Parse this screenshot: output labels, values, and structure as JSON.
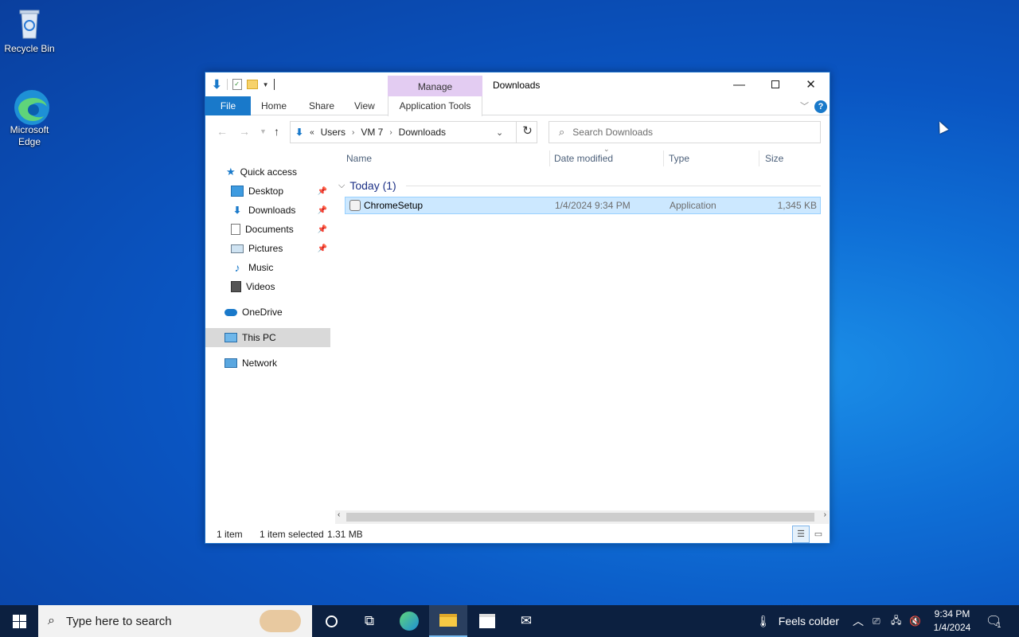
{
  "desktop": {
    "icons": [
      {
        "label": "Recycle Bin",
        "icon": "recycle-bin-icon"
      },
      {
        "label": "Microsoft Edge",
        "icon": "edge-icon"
      }
    ]
  },
  "window": {
    "title": "Downloads",
    "contextual_tab_group": "Manage",
    "ribbon_tabs": [
      "File",
      "Home",
      "Share",
      "View",
      "Application Tools"
    ],
    "controls": [
      "minimize",
      "maximize",
      "close"
    ]
  },
  "navigation": {
    "address_path": [
      "Users",
      "VM 7",
      "Downloads"
    ],
    "address_overflow": "«",
    "search_placeholder": "Search Downloads"
  },
  "nav_pane": {
    "quick_access": "Quick access",
    "items": [
      {
        "label": "Desktop",
        "pinned": true,
        "icon": "desktop-folder-icon"
      },
      {
        "label": "Downloads",
        "pinned": true,
        "icon": "downloads-folder-icon"
      },
      {
        "label": "Documents",
        "pinned": true,
        "icon": "documents-folder-icon"
      },
      {
        "label": "Pictures",
        "pinned": true,
        "icon": "pictures-folder-icon"
      },
      {
        "label": "Music",
        "pinned": false,
        "icon": "music-folder-icon"
      },
      {
        "label": "Videos",
        "pinned": false,
        "icon": "videos-folder-icon"
      }
    ],
    "onedrive": "OneDrive",
    "this_pc": "This PC",
    "network": "Network"
  },
  "file_list": {
    "columns": [
      "Name",
      "Date modified",
      "Type",
      "Size"
    ],
    "group_label": "Today (1)",
    "rows": [
      {
        "name": "ChromeSetup",
        "date_modified": "1/4/2024 9:34 PM",
        "type": "Application",
        "size": "1,345 KB",
        "selected": true
      }
    ]
  },
  "status_bar": {
    "item_count": "1 item",
    "selection": "1 item selected",
    "selection_size": "1.31 MB"
  },
  "taskbar": {
    "search_placeholder": "Type here to search",
    "weather": "Feels colder",
    "time": "9:34 PM",
    "date": "1/4/2024",
    "notification_count": "1"
  },
  "colors": {
    "accent": "#1979ca",
    "selection_bg": "#cce8ff",
    "taskbar_bg": "#0c2040",
    "manage_tab_bg": "#e3ccf2"
  }
}
